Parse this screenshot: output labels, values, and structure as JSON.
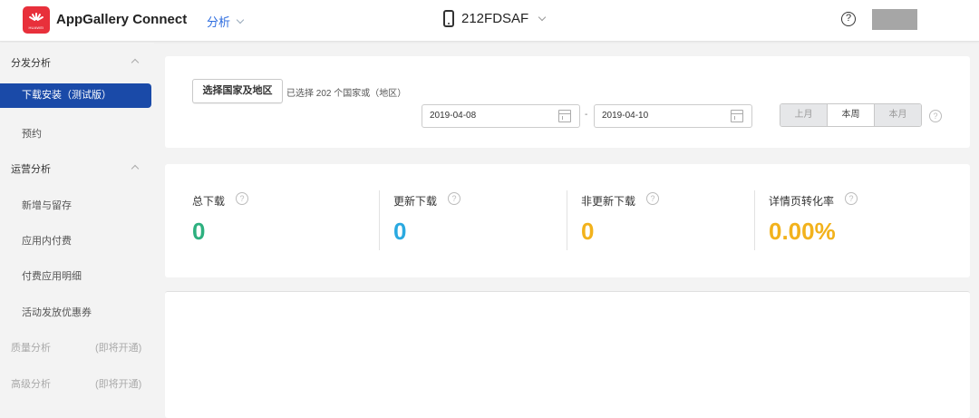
{
  "header": {
    "logo_text": "HUAWEI",
    "app_title": "AppGallery Connect",
    "nav_menu": "分析",
    "device_name": "212FDSAF",
    "help_icon": "help-circle-icon",
    "help_glyph": "?"
  },
  "sidebar": {
    "group1": "分发分析",
    "item_active": "下载安装（测试版）",
    "item_reserve": "预约",
    "group2": "运营分析",
    "item_new": "新增与留存",
    "item_iap": "应用内付费",
    "item_paid": "付费应用明细",
    "item_coupon": "活动发放优惠券",
    "group3": "质量分析",
    "group3_soon": "(即将开通)",
    "group4": "高级分析",
    "group4_soon": "(即将开通)"
  },
  "filter": {
    "region_button": "选择国家及地区",
    "region_note": "已选择 202 个国家或（地区）",
    "date_start": "2019-04-08",
    "date_end": "2019-04-10",
    "date_sep": "-",
    "range_options": [
      "上月",
      "本周",
      "本月"
    ],
    "range_active_index": 1,
    "help_glyph": "?"
  },
  "metrics": [
    {
      "label": "总下载",
      "value": "0",
      "color": "#2db07f"
    },
    {
      "label": "更新下载",
      "value": "0",
      "color": "#2aa9e0"
    },
    {
      "label": "非更新下载",
      "value": "0",
      "color": "#f2b21c"
    },
    {
      "label": "详情页转化率",
      "value": "0.00%",
      "color": "#f2b21c"
    }
  ],
  "colors": {
    "accent": "#1a4aa8",
    "brand_red": "#e8303b",
    "nav_link": "#2d6cdf"
  }
}
